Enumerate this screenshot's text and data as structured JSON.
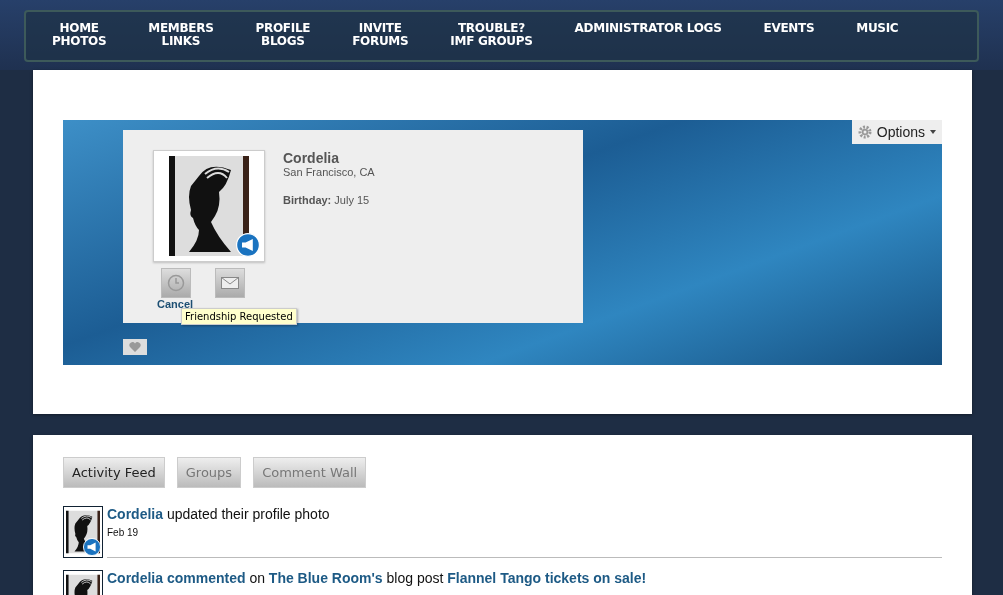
{
  "nav": {
    "columns": [
      {
        "items": [
          "HOME",
          "PHOTOS"
        ]
      },
      {
        "items": [
          "MEMBERS",
          "LINKS"
        ]
      },
      {
        "items": [
          "PROFILE",
          "BLOGS"
        ]
      },
      {
        "items": [
          "INVITE",
          "FORUMS"
        ]
      },
      {
        "items": [
          "TROUBLE?",
          "IMF GROUPS"
        ]
      },
      {
        "items": [
          "ADMINISTRATOR LOGS"
        ]
      },
      {
        "items": [
          "EVENTS"
        ]
      },
      {
        "items": [
          "MUSIC"
        ]
      }
    ]
  },
  "profile": {
    "options_button": "Options",
    "name": "Cordelia",
    "location": "San Francisco, CA",
    "birthday_label": "Birthday:",
    "birthday": "July 15",
    "cancel_link": "Cancel",
    "tooltip": "Friendship Requested"
  },
  "tabs": [
    {
      "label": "Activity Feed",
      "selected": true
    },
    {
      "label": "Groups",
      "selected": false
    },
    {
      "label": "Comment Wall",
      "selected": false
    }
  ],
  "feed": [
    {
      "parts": [
        {
          "kind": "link",
          "text": "Cordelia"
        },
        {
          "kind": "text",
          "text": "updated their profile photo"
        }
      ],
      "date": "Feb 19"
    },
    {
      "parts": [
        {
          "kind": "link",
          "text": "Cordelia commented"
        },
        {
          "kind": "text",
          "text": "on"
        },
        {
          "kind": "link",
          "text": "The Blue Room's"
        },
        {
          "kind": "text",
          "text": "blog post"
        },
        {
          "kind": "link",
          "text": "Flannel Tango tickets on sale!"
        }
      ]
    }
  ]
}
